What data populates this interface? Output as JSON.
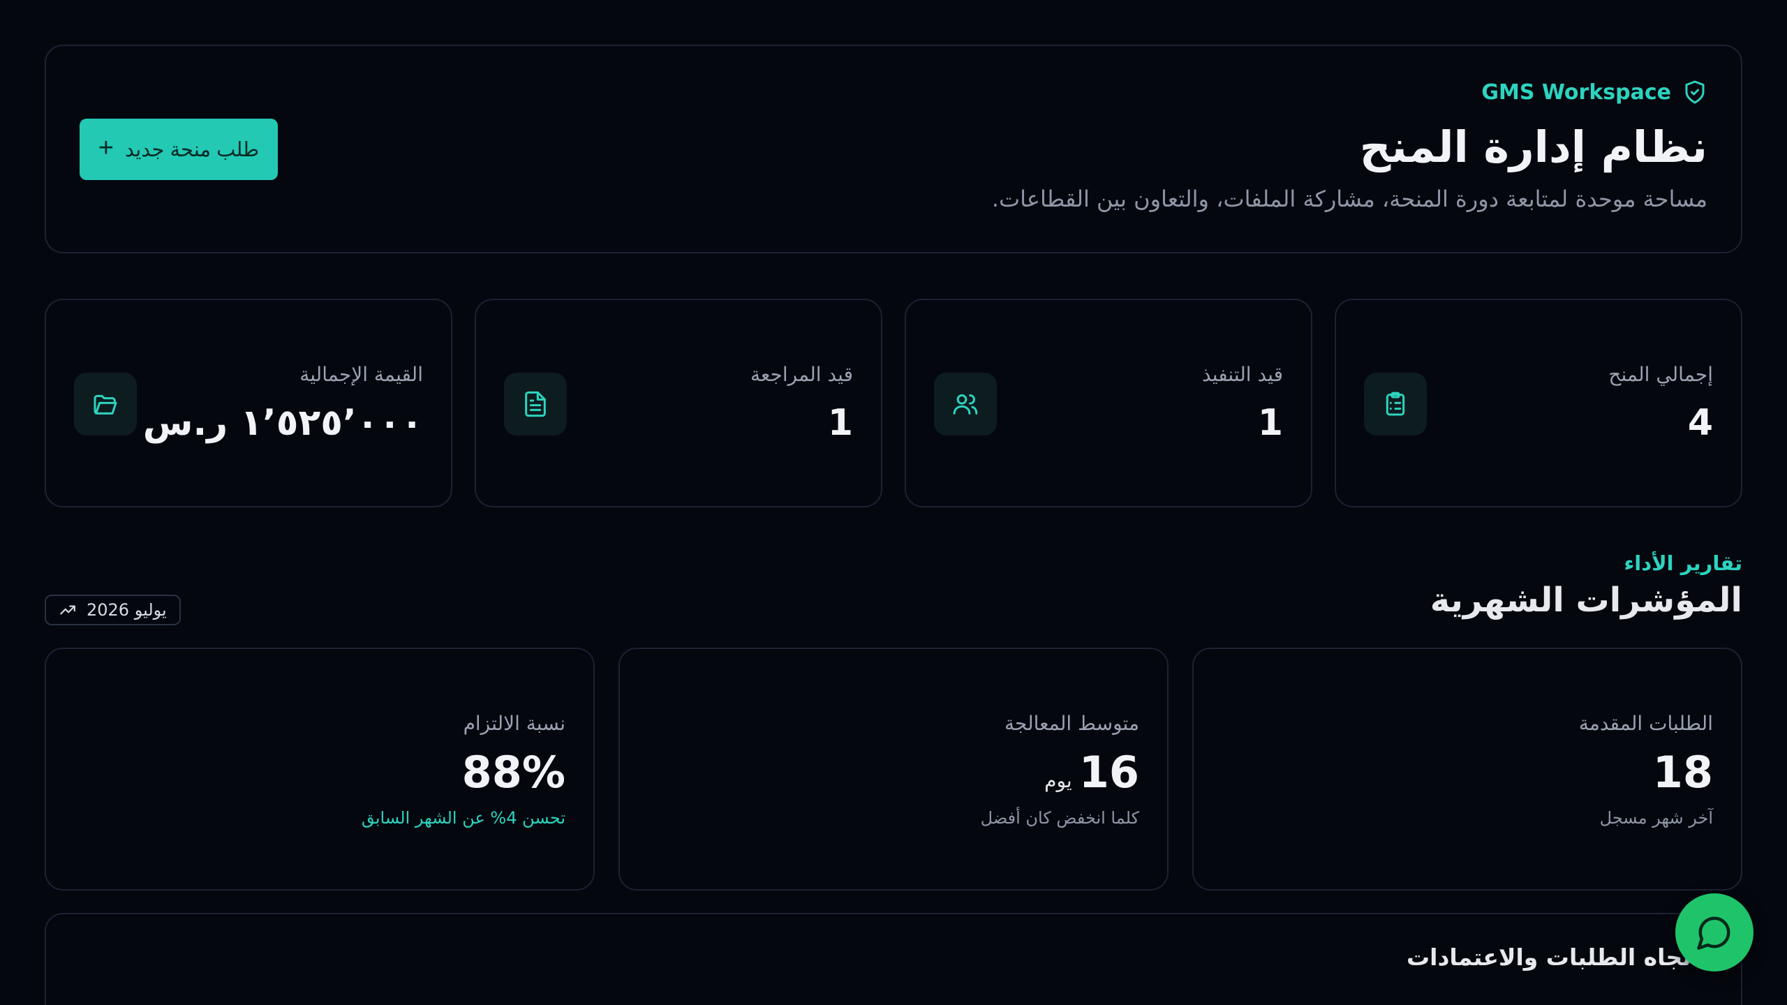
{
  "colors": {
    "background": "#05070f",
    "accent": "#23c9b3",
    "accent_text": "#2dd4bf",
    "chat_fab": "#1fc46a"
  },
  "header": {
    "workspace_label": "GMS Workspace",
    "workspace_icon": "shield-check-icon",
    "title": "نظام إدارة المنح",
    "subtitle": "مساحة موحدة لمتابعة دورة المنحة، مشاركة الملفات، والتعاون بين القطاعات.",
    "new_button_label": "طلب منحة جديد",
    "new_button_icon": "plus-icon"
  },
  "stats": [
    {
      "label": "إجمالي المنح",
      "value": "4",
      "icon": "clipboard-list-icon"
    },
    {
      "label": "قيد التنفيذ",
      "value": "1",
      "icon": "users-icon"
    },
    {
      "label": "قيد المراجعة",
      "value": "1",
      "icon": "file-text-icon"
    },
    {
      "label": "القيمة الإجمالية",
      "value": "١٬٥٢٥٬٠٠٠ ر.س",
      "icon": "folder-open-icon"
    }
  ],
  "reports": {
    "kicker": "تقارير الأداء",
    "title": "المؤشرات الشهرية",
    "period": "يوليو 2026",
    "period_icon": "trending-up-icon",
    "metrics": [
      {
        "label": "الطلبات المقدمة",
        "value": "18",
        "unit": "",
        "note": "آخر شهر مسجل"
      },
      {
        "label": "متوسط المعالجة",
        "value": "16",
        "unit": "يوم",
        "note": "كلما انخفض كان أفضل"
      },
      {
        "label": "نسبة الالتزام",
        "value": "88%",
        "unit": "",
        "note": "تحسن 4% عن الشهر السابق"
      }
    ]
  },
  "trend": {
    "title": "اتجاه الطلبات والاعتمادات"
  },
  "chat": {
    "icon": "chat-bubble-icon"
  }
}
